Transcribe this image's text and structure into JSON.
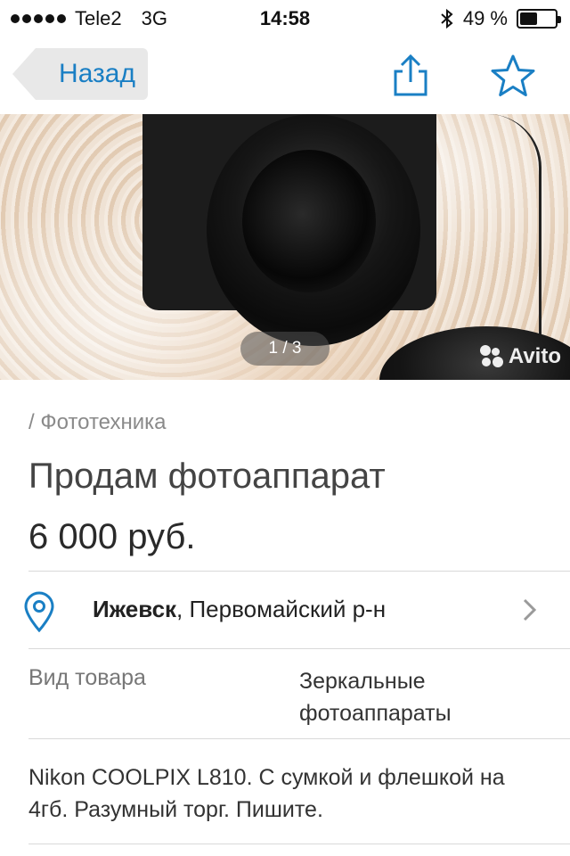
{
  "status_bar": {
    "carrier": "Tele2",
    "network": "3G",
    "time": "14:58",
    "battery_percent": "49 %",
    "battery_level": 0.49,
    "icons": [
      "signal-dots-icon",
      "bluetooth-icon",
      "battery-icon"
    ]
  },
  "nav": {
    "back_label": "Назад",
    "share_icon": "share-icon",
    "favorite_icon": "star-icon",
    "accent_color": "#1a7fc4"
  },
  "gallery": {
    "indicator": "1 / 3",
    "current": 1,
    "total": 3,
    "watermark": "Avito"
  },
  "listing": {
    "category": "/ Фототехника",
    "title": "Продам фотоаппарат",
    "price": "6 000 руб.",
    "location": {
      "city": "Ижевск",
      "district": ", Первомайский р-н"
    },
    "params": [
      {
        "label": "Вид товара",
        "value": "Зеркальные фотоаппараты"
      }
    ],
    "description": "Nikon COOLPIX L810. С сумкой и флешкой на 4гб. Разумный торг. Пишите."
  }
}
